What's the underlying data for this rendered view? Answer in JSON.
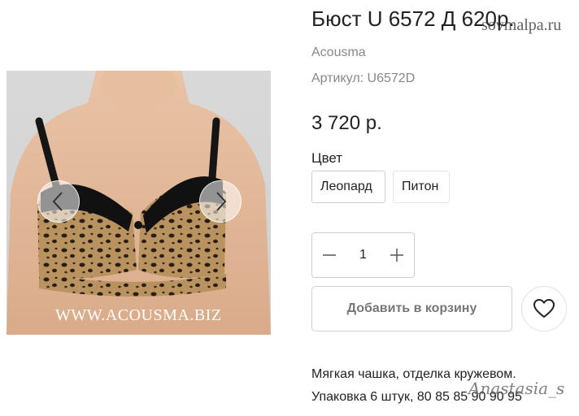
{
  "product": {
    "title": "Бюст U 6572 Д 620р.",
    "brand": "Acousma",
    "sku_label": "Артикул:",
    "sku_value": "U6572D",
    "price": "3 720 р.",
    "site_watermark": "sovmalpa.ru"
  },
  "gallery": {
    "image_caption": "WWW.ACOUSMA.BIZ",
    "prev_icon": "chevron-left-icon",
    "next_icon": "chevron-right-icon"
  },
  "color": {
    "label": "Цвет",
    "options": [
      "Леопард",
      "Питон"
    ],
    "selected": "Леопард"
  },
  "quantity": {
    "value": "1",
    "decrement_icon": "minus-icon",
    "increment_icon": "plus-icon"
  },
  "actions": {
    "add_to_cart": "Добавить в корзину",
    "favorite_icon": "heart-icon"
  },
  "description": {
    "line1": "Мягкая чашка, отделка кружевом.",
    "line2": "Упаковка 6 штук, 80 85 85 90 90 95",
    "signature": "Anastasia_s"
  },
  "colors": {
    "text": "#222222",
    "muted": "#888888",
    "border": "#d0d0d0",
    "button_text": "#777777"
  }
}
